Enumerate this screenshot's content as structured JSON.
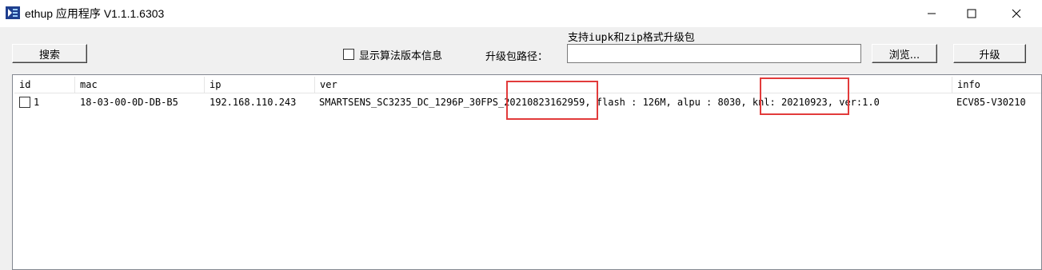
{
  "window": {
    "title": "ethup 应用程序 V1.1.1.6303",
    "icon": "ethup-app-icon"
  },
  "toolbar": {
    "search_label": "搜索",
    "show_algo_checkbox_label": "显示算法版本信息",
    "show_algo_checked": false,
    "path_label": "升级包路径：",
    "path_hint": "支持iupk和zip格式升级包",
    "path_value": "",
    "browse_label": "浏览...",
    "upgrade_label": "升级"
  },
  "table": {
    "columns": [
      "id",
      "mac",
      "ip",
      "ver",
      "info"
    ],
    "rows": [
      {
        "checked": false,
        "id": "1",
        "mac": "18-03-00-0D-DB-B5",
        "ip": "192.168.110.243",
        "ver": "SMARTSENS_SC3235_DC_1296P_30FPS_20210823162959, flash : 126M, alpu : 8030, knl: 20210923, ver:1.0",
        "info": "ECV85-V30210"
      }
    ]
  },
  "annotations": {
    "highlight_color": "#e23b3b"
  }
}
